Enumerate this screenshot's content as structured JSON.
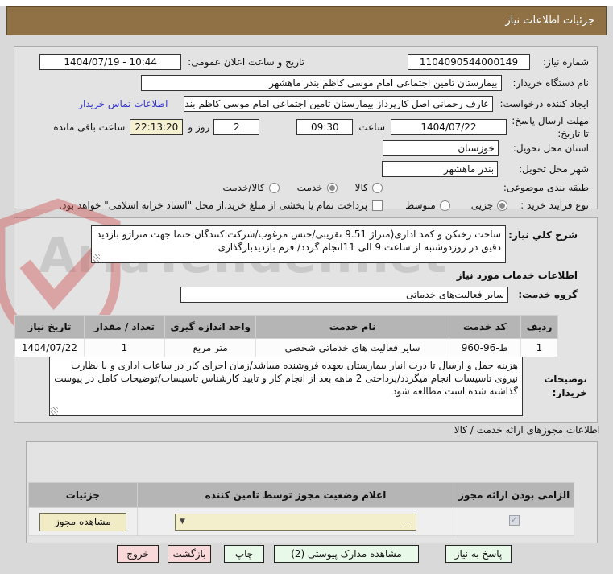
{
  "header": {
    "title": "جزئیات اطلاعات نیاز"
  },
  "form": {
    "need_number": {
      "label": "شماره نیاز:",
      "value": "1104090544000149"
    },
    "announce_datetime": {
      "label": "تاریخ و ساعت اعلان عمومی:",
      "value": "1404/07/19 - 10:44"
    },
    "buyer_org": {
      "label": "نام دستگاه خریدار:",
      "value": "بیمارستان تامین اجتماعی امام موسی کاظم بندر ماهشهر"
    },
    "request_creator": {
      "label": "ایجاد کننده درخواست:",
      "value": "عارف رحمانی اصل کارپرداز بیمارستان تامین اجتماعی امام موسی کاظم بندر ماه",
      "contact_link": "اطلاعات تماس خریدار"
    },
    "deadline": {
      "label": "مهلت ارسال پاسخ: تا تاریخ:",
      "date": "1404/07/22",
      "hour_label": "ساعت",
      "hour": "09:30",
      "days": "2",
      "days_label": "روز و",
      "remaining": "22:13:20",
      "remaining_label": "ساعت باقی مانده"
    },
    "province": {
      "label": "استان محل تحویل:",
      "value": "خوزستان"
    },
    "city": {
      "label": "شهر محل تحویل:",
      "value": "بندر ماهشهر"
    },
    "category": {
      "label": "طبقه بندی موضوعی:",
      "options": [
        {
          "label": "کالا",
          "selected": false
        },
        {
          "label": "خدمت",
          "selected": true
        },
        {
          "label": "کالا/خدمت",
          "selected": false
        }
      ]
    },
    "purchase_type": {
      "label": "نوع فرآیند خرید :",
      "options": [
        {
          "label": "جزیی",
          "selected": true
        },
        {
          "label": "متوسط",
          "selected": false
        }
      ],
      "checkbox_label": "پرداخت تمام یا بخشی از مبلغ خرید،از محل \"اسناد خزانه اسلامی\" خواهد بود.",
      "checkbox_checked": false
    }
  },
  "need_description": {
    "label": "شرح کلي نیاز:",
    "value": "ساخت رختکن و کمد اداری(متراژ 9.51 تقریبی/جنس مرغوب/شرکت کنندگان حتما جهت متراژو بازدید دقیق در روزدوشنبه از ساعت 9 الی 11انجام گردد/ فرم بازدیدبارگذاری"
  },
  "services_section": {
    "title": "اطلاعات خدمات مورد نیاز",
    "service_group": {
      "label": "گروه خدمت:",
      "value": "سایر فعالیت‌های خدماتی"
    },
    "table": {
      "headers": [
        "ردیف",
        "کد خدمت",
        "نام خدمت",
        "واحد اندازه گیری",
        "تعداد / مقدار",
        "تاریخ نیاز"
      ],
      "rows": [
        [
          "1",
          "ط-96-960",
          "سایر فعالیت های خدماتی شخصی",
          "متر مربع",
          "1",
          "1404/07/22"
        ]
      ]
    },
    "buyer_notes": {
      "label": "توضیحات خریدار:",
      "value": "هزینه حمل و ارسال تا درب انبار بیمارستان بعهده فروشنده میباشد/زمان اجرای کار در ساعات اداری و با نظارت نیروی تاسیسات انجام میگردد/پرداختی 2 ماهه بعد از انجام کار و تایید کارشناس تاسیسات/توضیحات کامل در پیوست گذاشته شده است مطالعه شود"
    }
  },
  "permits_section": {
    "title": "اطلاعات مجوزهای ارائه خدمت / کالا",
    "table_headers": [
      "الزامی بودن ارائه مجوز",
      "اعلام وضعیت مجوز توسط تامین کننده",
      "جزئیات"
    ],
    "row": {
      "required_checked": true,
      "status_value": "--",
      "details_button": "مشاهده مجوز"
    }
  },
  "footer_buttons": [
    {
      "label": "پاسخ به نیاز",
      "style": "green"
    },
    {
      "label": "مشاهده مدارک پیوستی (2)",
      "style": "green"
    },
    {
      "label": "چاپ",
      "style": "green"
    },
    {
      "label": "بازگشت",
      "style": "pink"
    },
    {
      "label": "خروج",
      "style": "pink"
    }
  ],
  "watermark": {
    "text": "AriaTender.net"
  },
  "colors": {
    "titlebar": "#8f7145",
    "panel": "#e3e3e3",
    "highlight": "#f6f0d2",
    "link": "#3535cf",
    "table_header": "#b5b5b5",
    "button_green": "#e9f9e9",
    "button_pink": "#f8d8d8",
    "cream": "#f1ecc6"
  }
}
